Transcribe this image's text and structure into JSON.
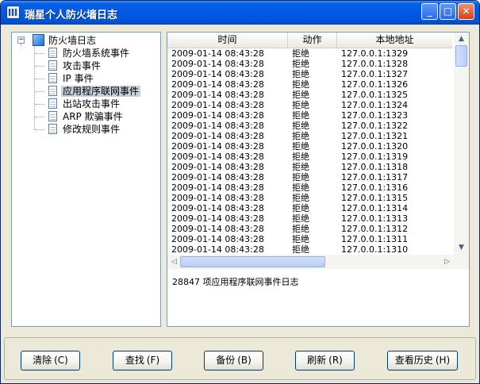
{
  "window": {
    "title": "瑞星个人防火墙日志"
  },
  "titlebar_buttons": {
    "minimize": "_",
    "maximize": "□",
    "close": "✕"
  },
  "tree": {
    "root": "防火墙日志",
    "root_toggle": "−",
    "items": [
      {
        "label": "防火墙系统事件",
        "selected": false
      },
      {
        "label": "攻击事件",
        "selected": false
      },
      {
        "label": "IP 事件",
        "selected": false
      },
      {
        "label": "应用程序联网事件",
        "selected": true
      },
      {
        "label": "出站攻击事件",
        "selected": false
      },
      {
        "label": "ARP 欺骗事件",
        "selected": false
      },
      {
        "label": "修改规则事件",
        "selected": false
      }
    ]
  },
  "table": {
    "columns": [
      "时间",
      "动作",
      "本地地址"
    ],
    "rows": [
      [
        "2009-01-14 08:43:28",
        "拒绝",
        "127.0.0.1:1329"
      ],
      [
        "2009-01-14 08:43:28",
        "拒绝",
        "127.0.0.1:1328"
      ],
      [
        "2009-01-14 08:43:28",
        "拒绝",
        "127.0.0.1:1327"
      ],
      [
        "2009-01-14 08:43:28",
        "拒绝",
        "127.0.0.1:1326"
      ],
      [
        "2009-01-14 08:43:28",
        "拒绝",
        "127.0.0.1:1325"
      ],
      [
        "2009-01-14 08:43:28",
        "拒绝",
        "127.0.0.1:1324"
      ],
      [
        "2009-01-14 08:43:28",
        "拒绝",
        "127.0.0.1:1323"
      ],
      [
        "2009-01-14 08:43:28",
        "拒绝",
        "127.0.0.1:1322"
      ],
      [
        "2009-01-14 08:43:28",
        "拒绝",
        "127.0.0.1:1321"
      ],
      [
        "2009-01-14 08:43:28",
        "拒绝",
        "127.0.0.1:1320"
      ],
      [
        "2009-01-14 08:43:28",
        "拒绝",
        "127.0.0.1:1319"
      ],
      [
        "2009-01-14 08:43:28",
        "拒绝",
        "127.0.0.1:1318"
      ],
      [
        "2009-01-14 08:43:28",
        "拒绝",
        "127.0.0.1:1317"
      ],
      [
        "2009-01-14 08:43:28",
        "拒绝",
        "127.0.0.1:1316"
      ],
      [
        "2009-01-14 08:43:28",
        "拒绝",
        "127.0.0.1:1315"
      ],
      [
        "2009-01-14 08:43:28",
        "拒绝",
        "127.0.0.1:1314"
      ],
      [
        "2009-01-14 08:43:28",
        "拒绝",
        "127.0.0.1:1313"
      ],
      [
        "2009-01-14 08:43:28",
        "拒绝",
        "127.0.0.1:1312"
      ],
      [
        "2009-01-14 08:43:28",
        "拒绝",
        "127.0.0.1:1311"
      ],
      [
        "2009-01-14 08:43:28",
        "拒绝",
        "127.0.0.1:1310"
      ]
    ]
  },
  "status_text": "28847 项应用程序联网事件日志",
  "buttons": [
    {
      "label": "清除",
      "hotkey": "(C)"
    },
    {
      "label": "查找",
      "hotkey": "(F)"
    },
    {
      "label": "备份",
      "hotkey": "(B)"
    },
    {
      "label": "刷新",
      "hotkey": "(R)"
    },
    {
      "label": "查看历史",
      "hotkey": "(H)"
    }
  ],
  "scroll_arrows": {
    "up": "▲",
    "down": "▼",
    "left": "◁",
    "right": "▷"
  },
  "colors": {
    "title_bar": "#0058e6",
    "window_bg": "#ece9d8",
    "selected_tree_bg": "#c8d0dc",
    "panel_border": "#7f9db9"
  }
}
